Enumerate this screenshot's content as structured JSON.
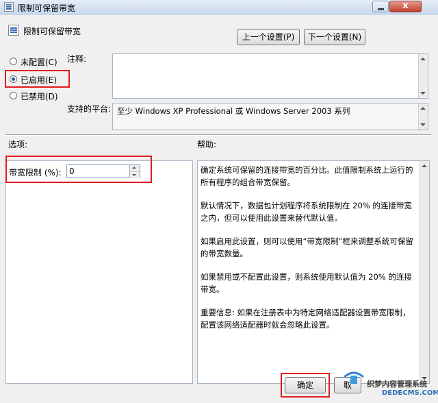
{
  "window": {
    "title": "限制可保留带宽",
    "close_glyph": "x"
  },
  "header": {
    "setting_name": "限制可保留带宽",
    "prev_button": "上一个设置(P)",
    "next_button": "下一个设置(N)"
  },
  "state": {
    "options": [
      {
        "label": "未配置(C)",
        "selected": false
      },
      {
        "label": "已启用(E)",
        "selected": true
      },
      {
        "label": "已禁用(D)",
        "selected": false
      }
    ]
  },
  "comment": {
    "label": "注释:",
    "value": ""
  },
  "platform": {
    "label": "支持的平台:",
    "value": "至少 Windows XP Professional 或 Windows Server 2003 系列"
  },
  "options_section": {
    "label": "选项:",
    "bandwidth_label": "带宽限制 (%):",
    "bandwidth_value": "0"
  },
  "help_section": {
    "label": "帮助:",
    "paragraphs": [
      "确定系统可保留的连接带宽的百分比。此值限制系统上运行的所有程序的组合带宽保留。",
      "默认情况下，数据包计划程序将系统限制在 20% 的连接带宽之内，但可以使用此设置来替代默认值。",
      "如果启用此设置，则可以使用“带宽限制”框来调整系统可保留的带宽数量。",
      "如果禁用或不配置此设置，则系统使用默认值为 20% 的连接带宽。",
      "重要信息: 如果在注册表中为特定网络适配器设置带宽限制，配置该网络适配器时就会忽略此设置。"
    ]
  },
  "footer": {
    "ok_button": "确定",
    "cancel_button": "取"
  },
  "watermark": {
    "line1": "织梦内容管理系统",
    "line2": "DEDECMS.COM"
  },
  "colors": {
    "highlight_red": "#e01c1c",
    "radio_dot": "#2b4f92"
  }
}
